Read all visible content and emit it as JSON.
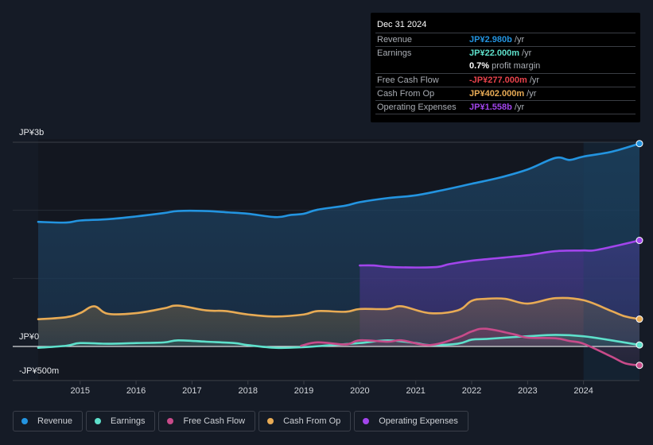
{
  "tooltip": {
    "date": "Dec 31 2024",
    "rows": [
      {
        "label": "Revenue",
        "value": "JP¥2.980b",
        "unit": " /yr",
        "color": "#2394e0"
      },
      {
        "label": "Earnings",
        "value": "JP¥22.000m",
        "unit": " /yr",
        "color": "#5ee0cb"
      },
      {
        "label": "",
        "value": "0.7%",
        "unit": " profit margin",
        "color": "#ffffff"
      },
      {
        "label": "Free Cash Flow",
        "value": "-JP¥277.000m",
        "unit": " /yr",
        "color": "#e8424b"
      },
      {
        "label": "Cash From Op",
        "value": "JP¥402.000m",
        "unit": " /yr",
        "color": "#e8ab55"
      },
      {
        "label": "Operating Expenses",
        "value": "JP¥1.558b",
        "unit": " /yr",
        "color": "#a245ec"
      }
    ]
  },
  "legend": [
    {
      "label": "Revenue",
      "color": "#2394e0"
    },
    {
      "label": "Earnings",
      "color": "#5ee0cb"
    },
    {
      "label": "Free Cash Flow",
      "color": "#c84b8a"
    },
    {
      "label": "Cash From Op",
      "color": "#e8ab55"
    },
    {
      "label": "Operating Expenses",
      "color": "#a245ec"
    }
  ],
  "chart_data": {
    "type": "area",
    "title": "",
    "xlabel": "",
    "ylabel": "",
    "y_unit": "JPY billions",
    "ylim": [
      -0.5,
      3.0
    ],
    "xlim": [
      2014.25,
      2025.0
    ],
    "highlight_from": 2024.0,
    "y_tick_labels": [
      {
        "value": 3.0,
        "label": "JP¥3b"
      },
      {
        "value": 0.0,
        "label": "JP¥0"
      },
      {
        "value": -0.5,
        "label": "-JP¥500m"
      }
    ],
    "gridlines": [
      3.0,
      2.0,
      1.0,
      0.0
    ],
    "x_ticks": [
      2015,
      2016,
      2017,
      2018,
      2019,
      2020,
      2021,
      2022,
      2023,
      2024
    ],
    "grid": true,
    "legend_position": "bottom",
    "series": [
      {
        "name": "Revenue",
        "color": "#2394e0",
        "x": [
          2014.25,
          2014.75,
          2015.0,
          2015.5,
          2016.0,
          2016.5,
          2016.75,
          2017.25,
          2017.65,
          2018.0,
          2018.5,
          2018.75,
          2019.0,
          2019.25,
          2019.75,
          2020.0,
          2020.5,
          2021.0,
          2021.5,
          2022.0,
          2022.5,
          2023.0,
          2023.5,
          2023.75,
          2024.0,
          2024.5,
          2025.0
        ],
        "values": [
          1.83,
          1.82,
          1.85,
          1.87,
          1.91,
          1.96,
          1.99,
          1.99,
          1.97,
          1.95,
          1.9,
          1.93,
          1.95,
          2.01,
          2.07,
          2.12,
          2.18,
          2.22,
          2.3,
          2.39,
          2.48,
          2.6,
          2.77,
          2.74,
          2.79,
          2.86,
          2.98
        ]
      },
      {
        "name": "Operating Expenses",
        "color": "#a245ec",
        "x": [
          2020.0,
          2020.25,
          2020.5,
          2021.0,
          2021.4,
          2021.6,
          2022.0,
          2022.5,
          2023.0,
          2023.5,
          2024.0,
          2024.25,
          2025.0
        ],
        "values": [
          1.19,
          1.19,
          1.17,
          1.16,
          1.17,
          1.21,
          1.26,
          1.3,
          1.34,
          1.4,
          1.41,
          1.42,
          1.558
        ]
      },
      {
        "name": "Cash From Op",
        "color": "#e8ab55",
        "x": [
          2014.25,
          2014.75,
          2015.0,
          2015.25,
          2015.5,
          2016.0,
          2016.5,
          2016.75,
          2017.25,
          2017.6,
          2018.0,
          2018.5,
          2019.0,
          2019.25,
          2019.75,
          2020.0,
          2020.5,
          2020.75,
          2021.25,
          2021.75,
          2022.0,
          2022.25,
          2022.6,
          2023.0,
          2023.5,
          2024.0,
          2024.5,
          2024.75,
          2025.0
        ],
        "values": [
          0.4,
          0.43,
          0.49,
          0.59,
          0.48,
          0.49,
          0.56,
          0.6,
          0.53,
          0.52,
          0.47,
          0.44,
          0.47,
          0.52,
          0.51,
          0.55,
          0.55,
          0.59,
          0.49,
          0.53,
          0.67,
          0.7,
          0.7,
          0.63,
          0.71,
          0.68,
          0.52,
          0.44,
          0.402
        ]
      },
      {
        "name": "Earnings",
        "color": "#5ee0cb",
        "x": [
          2014.25,
          2014.75,
          2015.0,
          2015.5,
          2016.0,
          2016.5,
          2016.75,
          2017.25,
          2017.75,
          2018.0,
          2018.5,
          2019.0,
          2019.5,
          2020.0,
          2020.5,
          2021.0,
          2021.25,
          2021.75,
          2022.0,
          2022.25,
          2022.6,
          2023.0,
          2023.5,
          2024.0,
          2024.5,
          2025.0
        ],
        "values": [
          -0.02,
          0.01,
          0.05,
          0.04,
          0.05,
          0.06,
          0.09,
          0.07,
          0.05,
          0.02,
          -0.02,
          -0.01,
          0.02,
          0.05,
          0.09,
          0.05,
          0.02,
          0.04,
          0.1,
          0.11,
          0.13,
          0.15,
          0.17,
          0.15,
          0.09,
          0.022
        ]
      },
      {
        "name": "Free Cash Flow",
        "color": "#c84b8a",
        "x": [
          2018.95,
          2019.25,
          2019.75,
          2020.0,
          2020.5,
          2020.75,
          2021.25,
          2021.75,
          2022.0,
          2022.25,
          2022.75,
          2023.0,
          2023.5,
          2023.75,
          2024.0,
          2024.5,
          2024.75,
          2025.0
        ],
        "values": [
          0.01,
          0.06,
          0.03,
          0.09,
          0.07,
          0.09,
          0.02,
          0.13,
          0.22,
          0.26,
          0.18,
          0.13,
          0.12,
          0.08,
          0.04,
          -0.15,
          -0.25,
          -0.277
        ]
      }
    ]
  }
}
